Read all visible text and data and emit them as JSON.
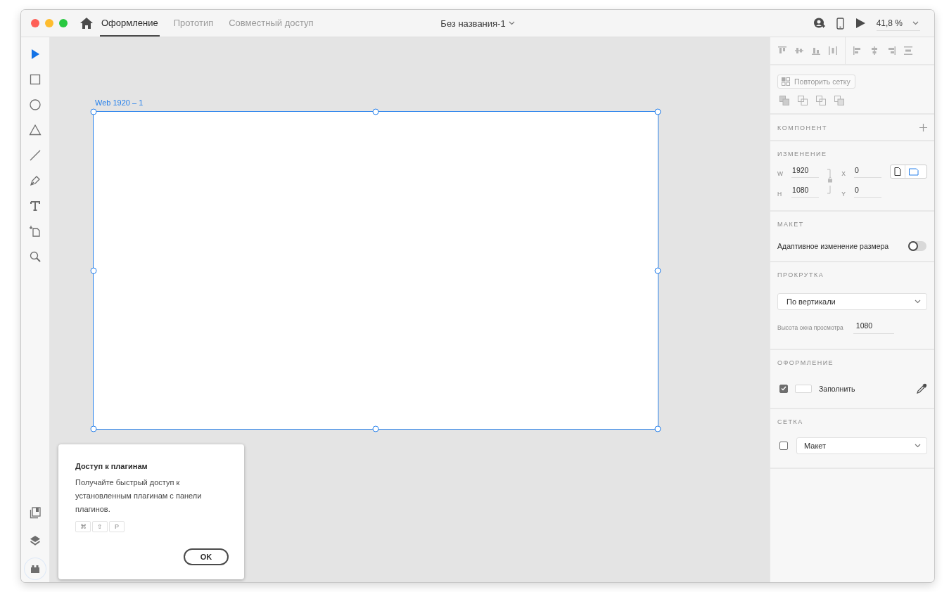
{
  "window": {
    "title": "Без названия-1"
  },
  "tabs": [
    {
      "label": "Оформление",
      "selected": true
    },
    {
      "label": "Прототип",
      "selected": false
    },
    {
      "label": "Совместный доступ",
      "selected": false
    }
  ],
  "zoom": "41,8 %",
  "tools": [
    {
      "kind": "select",
      "selected": true
    },
    {
      "kind": "rectangle",
      "selected": false
    },
    {
      "kind": "ellipse",
      "selected": false
    },
    {
      "kind": "polygon",
      "selected": false
    },
    {
      "kind": "line",
      "selected": false
    },
    {
      "kind": "pen",
      "selected": false
    },
    {
      "kind": "text",
      "selected": false
    },
    {
      "kind": "artboard",
      "selected": false
    },
    {
      "kind": "zoom",
      "selected": false
    }
  ],
  "bottom_tools": [
    {
      "kind": "assets",
      "selected": false
    },
    {
      "kind": "layers",
      "selected": false
    },
    {
      "kind": "plugins",
      "selected": true
    }
  ],
  "artboard": {
    "label": "Web 1920 – 1"
  },
  "popup": {
    "title": "Доступ к плагинам",
    "text": "Получайте быстрый доступ к установленным плагинам с панели плагинов.",
    "keys": [
      "⌘",
      "⇧",
      "P"
    ],
    "button": "OK"
  },
  "panel": {
    "repeat_grid": "Повторить сетку",
    "component": {
      "title": "КОМПОНЕНТ"
    },
    "transform": {
      "title": "ИЗМЕНЕНИЕ",
      "fields": [
        {
          "label": "W",
          "value": "1920"
        },
        {
          "label": "X",
          "value": "0"
        },
        {
          "label": "H",
          "value": "1080"
        },
        {
          "label": "Y",
          "value": "0"
        }
      ]
    },
    "layout": {
      "title": "МАКЕТ",
      "responsive": {
        "label": "Адаптивное изменение размера",
        "on": false
      }
    },
    "scrolling": {
      "title": "ПРОКРУТКА",
      "dropdown": "По вертикали",
      "viewport_label": "Высота окна просмотра",
      "viewport_value": "1080"
    },
    "appearance": {
      "title": "ОФОРМЛЕНИЕ",
      "fill": {
        "checked": true,
        "label": "Заполнить",
        "color": "#ffffff"
      }
    },
    "grid": {
      "title": "СЕТКА",
      "checked": false,
      "dropdown": "Макет"
    }
  }
}
